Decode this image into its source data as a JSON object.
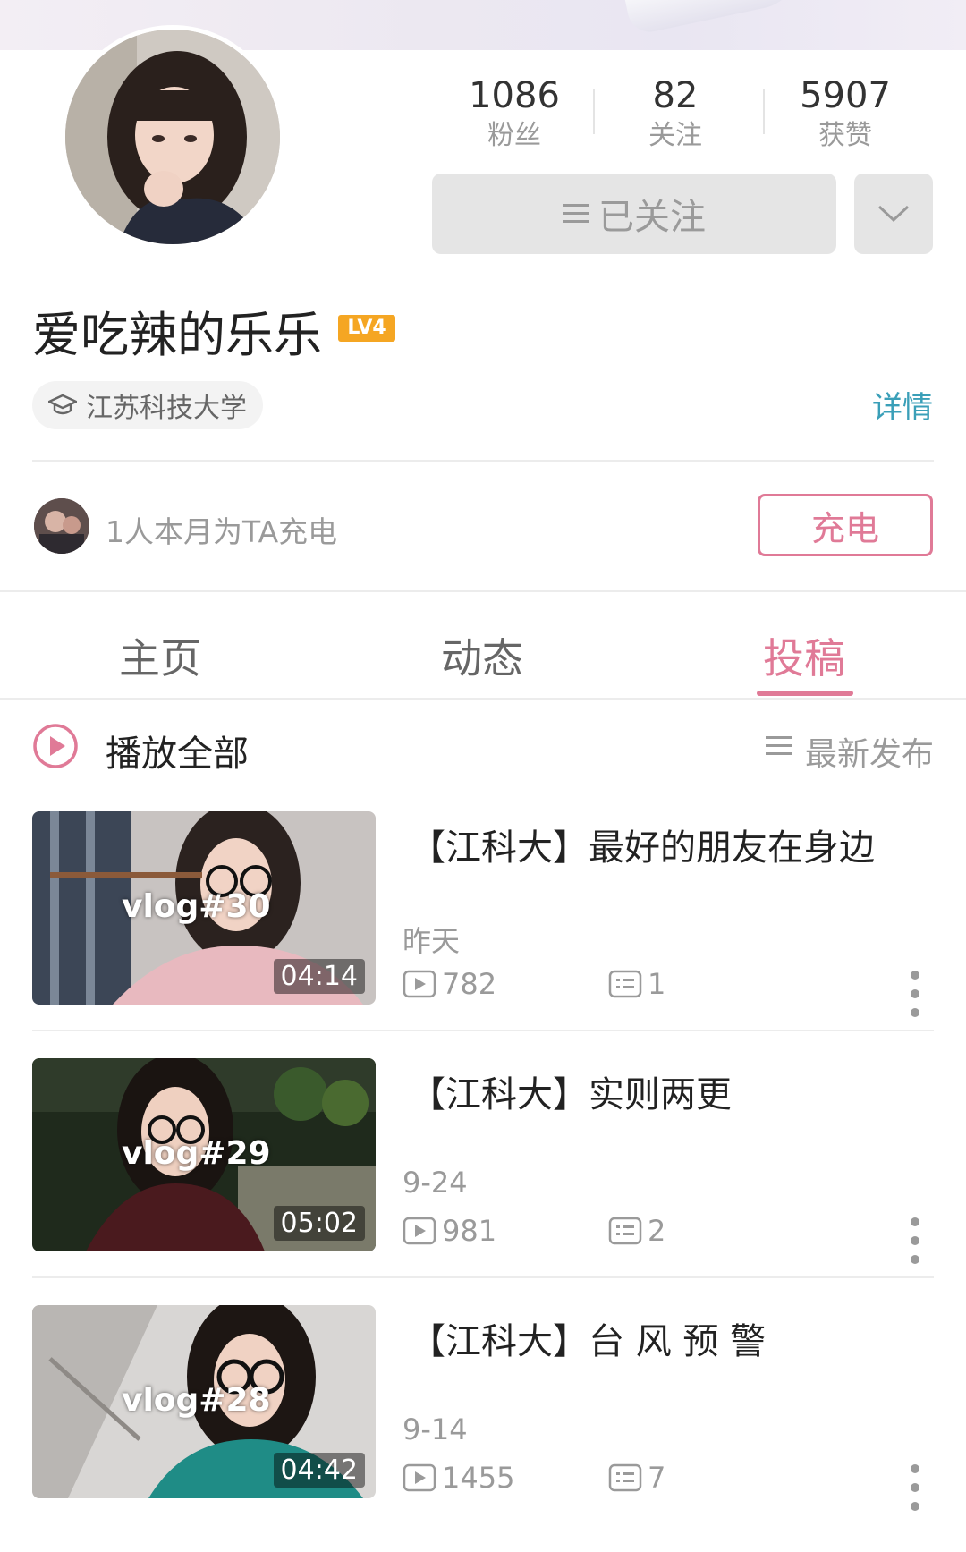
{
  "profile": {
    "stats": [
      {
        "value": "1086",
        "label": "粉丝"
      },
      {
        "value": "82",
        "label": "关注"
      },
      {
        "value": "5907",
        "label": "获赞"
      }
    ],
    "follow_label": "已关注",
    "nickname": "爱吃辣的乐乐",
    "level": "LV4",
    "school": "江苏科技大学",
    "detail_link": "详情"
  },
  "charge": {
    "text": "1人本月为TA充电",
    "button": "充电"
  },
  "tabs": [
    {
      "label": "主页",
      "active": false
    },
    {
      "label": "动态",
      "active": false
    },
    {
      "label": "投稿",
      "active": true
    }
  ],
  "list_header": {
    "play_all": "播放全部",
    "sort": "最新发布"
  },
  "videos": [
    {
      "title": "【江科大】最好的朋友在身边",
      "date": "昨天",
      "plays": "782",
      "comments": "1",
      "duration": "04:14",
      "tag": "vlog#30"
    },
    {
      "title": "【江科大】实则两更",
      "date": "9-24",
      "plays": "981",
      "comments": "2",
      "duration": "05:02",
      "tag": "vlog#29"
    },
    {
      "title": "【江科大】台 风 预 警",
      "date": "9-14",
      "plays": "1455",
      "comments": "7",
      "duration": "04:42",
      "tag": "vlog#28"
    }
  ],
  "colors": {
    "accent_pink": "#e07a97",
    "link_teal": "#3a9fb8",
    "level_badge": "#f5a623"
  },
  "icons": {
    "follow_prefix": "menu-lines-icon",
    "more": "chevron-down-icon",
    "school": "graduation-cap-icon",
    "play_all": "play-circle-icon",
    "sort": "sort-lines-icon",
    "plays": "play-box-icon",
    "comments": "comment-box-icon",
    "menu": "more-vertical-icon"
  }
}
